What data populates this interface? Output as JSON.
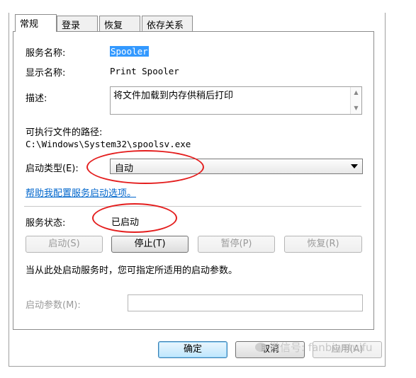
{
  "tabs": [
    {
      "label": "常规"
    },
    {
      "label": "登录"
    },
    {
      "label": "恢复"
    },
    {
      "label": "依存关系"
    }
  ],
  "service_name": {
    "label": "服务名称:",
    "value": "Spooler"
  },
  "display_name": {
    "label": "显示名称:",
    "value": "Print Spooler"
  },
  "description": {
    "label": "描述:",
    "value": "将文件加载到内存供稍后打印"
  },
  "exec_path": {
    "label": "可执行文件的路径:",
    "value": "C:\\Windows\\System32\\spoolsv.exe"
  },
  "startup_type": {
    "label": "启动类型(E):",
    "value": "自动"
  },
  "help_link": "帮助我配置服务启动选项。",
  "service_status": {
    "label": "服务状态:",
    "value": "已启动"
  },
  "control_buttons": {
    "start": "启动(S)",
    "stop": "停止(T)",
    "pause": "暂停(P)",
    "resume": "恢复(R)"
  },
  "hint_text": "当从此处启动服务时，您可指定所适用的启动参数。",
  "start_params": {
    "label": "启动参数(M):",
    "value": ""
  },
  "footer": {
    "ok": "确定",
    "cancel": "取消",
    "apply": "应用(A)"
  },
  "watermark": "微信号: fanbiantuifu",
  "colors": {
    "annotation": "#e41e1e",
    "link": "#0066cc",
    "selection": "#3399ff"
  }
}
